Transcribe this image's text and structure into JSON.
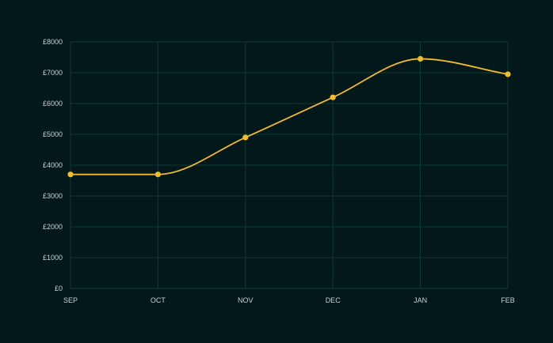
{
  "colors": {
    "background": "#02181a",
    "grid": "#0d3b2e",
    "line": "#f2bc2e",
    "point": "#f2bc2e",
    "tick_text": "#c9d3d0"
  },
  "chart_data": {
    "type": "line",
    "title": "",
    "xlabel": "",
    "ylabel": "",
    "categories": [
      "SEP",
      "OCT",
      "NOV",
      "DEC",
      "JAN",
      "FEB"
    ],
    "y_tick_values": [
      0,
      1000,
      2000,
      3000,
      4000,
      5000,
      6000,
      7000,
      8000
    ],
    "y_tick_labels": [
      "£0",
      "£1000",
      "£2000",
      "£3000",
      "£4000",
      "£5000",
      "£6000",
      "£7000",
      "£8000"
    ],
    "ylim": [
      0,
      8000
    ],
    "grid": true,
    "legend": "none",
    "curve": "smooth",
    "series": [
      {
        "values": [
          3700,
          3700,
          4900,
          6200,
          7450,
          6950
        ]
      }
    ]
  }
}
